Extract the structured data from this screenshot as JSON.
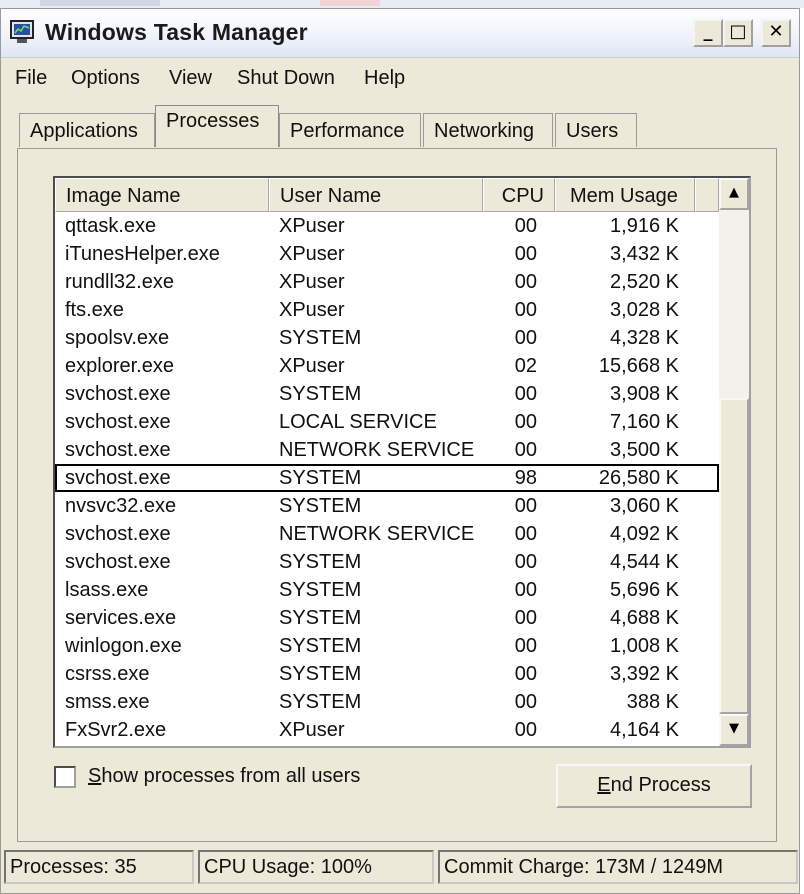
{
  "window": {
    "title": "Windows Task Manager"
  },
  "menu": [
    "File",
    "Options",
    "View",
    "Shut Down",
    "Help"
  ],
  "tabs": [
    {
      "label": "Applications",
      "active": false
    },
    {
      "label": "Processes",
      "active": true
    },
    {
      "label": "Performance",
      "active": false
    },
    {
      "label": "Networking",
      "active": false
    },
    {
      "label": "Users",
      "active": false
    }
  ],
  "table": {
    "columns": [
      "Image Name",
      "User Name",
      "CPU",
      "Mem Usage"
    ],
    "rows": [
      {
        "name": "qttask.exe",
        "user": "XPuser",
        "cpu": "00",
        "mem": "1,916 K"
      },
      {
        "name": "iTunesHelper.exe",
        "user": "XPuser",
        "cpu": "00",
        "mem": "3,432 K"
      },
      {
        "name": "rundll32.exe",
        "user": "XPuser",
        "cpu": "00",
        "mem": "2,520 K"
      },
      {
        "name": "fts.exe",
        "user": "XPuser",
        "cpu": "00",
        "mem": "3,028 K"
      },
      {
        "name": "spoolsv.exe",
        "user": "SYSTEM",
        "cpu": "00",
        "mem": "4,328 K"
      },
      {
        "name": "explorer.exe",
        "user": "XPuser",
        "cpu": "02",
        "mem": "15,668 K"
      },
      {
        "name": "svchost.exe",
        "user": "SYSTEM",
        "cpu": "00",
        "mem": "3,908 K"
      },
      {
        "name": "svchost.exe",
        "user": "LOCAL SERVICE",
        "cpu": "00",
        "mem": "7,160 K"
      },
      {
        "name": "svchost.exe",
        "user": "NETWORK SERVICE",
        "cpu": "00",
        "mem": "3,500 K"
      },
      {
        "name": "svchost.exe",
        "user": "SYSTEM",
        "cpu": "98",
        "mem": "26,580 K",
        "selected": true
      },
      {
        "name": "nvsvc32.exe",
        "user": "SYSTEM",
        "cpu": "00",
        "mem": "3,060 K"
      },
      {
        "name": "svchost.exe",
        "user": "NETWORK SERVICE",
        "cpu": "00",
        "mem": "4,092 K"
      },
      {
        "name": "svchost.exe",
        "user": "SYSTEM",
        "cpu": "00",
        "mem": "4,544 K"
      },
      {
        "name": "lsass.exe",
        "user": "SYSTEM",
        "cpu": "00",
        "mem": "5,696 K"
      },
      {
        "name": "services.exe",
        "user": "SYSTEM",
        "cpu": "00",
        "mem": "4,688 K"
      },
      {
        "name": "winlogon.exe",
        "user": "SYSTEM",
        "cpu": "00",
        "mem": "1,008 K"
      },
      {
        "name": "csrss.exe",
        "user": "SYSTEM",
        "cpu": "00",
        "mem": "3,392 K"
      },
      {
        "name": "smss.exe",
        "user": "SYSTEM",
        "cpu": "00",
        "mem": "388 K"
      },
      {
        "name": "FxSvr2.exe",
        "user": "XPuser",
        "cpu": "00",
        "mem": "4,164 K"
      }
    ]
  },
  "options": {
    "show_all_prefix": "S",
    "show_all_rest": "how processes from all users",
    "show_all_checked": false,
    "end_prefix": "E",
    "end_rest": "nd Process"
  },
  "status": {
    "processes": "Processes: 35",
    "cpu": "CPU Usage: 100%",
    "commit": "Commit Charge: 173M / 1249M"
  }
}
